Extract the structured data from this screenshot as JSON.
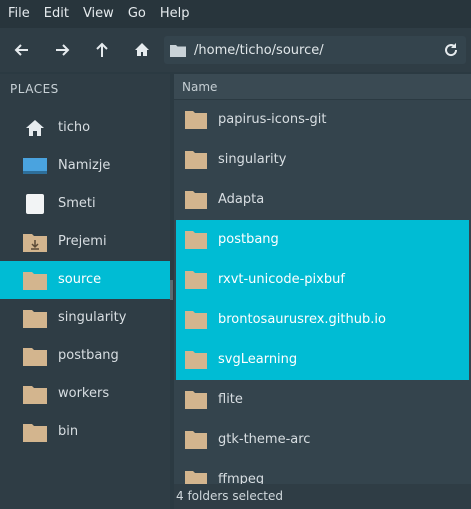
{
  "menubar": {
    "items": [
      "File",
      "Edit",
      "View",
      "Go",
      "Help"
    ]
  },
  "toolbar": {
    "back_icon": "arrow-left-icon",
    "forward_icon": "arrow-right-icon",
    "up_icon": "arrow-up-icon",
    "home_icon": "home-icon",
    "location_path": "/home/ticho/source/",
    "reload_icon": "reload-icon"
  },
  "sidebar": {
    "heading": "PLACES",
    "items": [
      {
        "label": "ticho",
        "icon": "home-icon",
        "active": false
      },
      {
        "label": "Namizje",
        "icon": "desktop-icon",
        "active": false
      },
      {
        "label": "Smeti",
        "icon": "trash-icon",
        "active": false
      },
      {
        "label": "Prejemi",
        "icon": "downloads-folder-icon",
        "active": false
      },
      {
        "label": "source",
        "icon": "folder-icon",
        "active": true
      },
      {
        "label": "singularity",
        "icon": "folder-icon",
        "active": false
      },
      {
        "label": "postbang",
        "icon": "folder-icon",
        "active": false
      },
      {
        "label": "workers",
        "icon": "folder-icon",
        "active": false
      },
      {
        "label": "bin",
        "icon": "folder-icon",
        "active": false
      }
    ]
  },
  "file_list": {
    "column_header": "Name",
    "rows": [
      {
        "name": "papirus-icons-git",
        "selected": false
      },
      {
        "name": "singularity",
        "selected": false
      },
      {
        "name": "Adapta",
        "selected": false
      },
      {
        "name": "postbang",
        "selected": true
      },
      {
        "name": "rxvt-unicode-pixbuf",
        "selected": true
      },
      {
        "name": "brontosaurusrex.github.io",
        "selected": true
      },
      {
        "name": "svgLearning",
        "selected": true
      },
      {
        "name": "flite",
        "selected": false
      },
      {
        "name": "gtk-theme-arc",
        "selected": false
      },
      {
        "name": "ffmpeg",
        "selected": false
      }
    ]
  },
  "status": {
    "text": "4 folders selected"
  },
  "colors": {
    "accent": "#00bcd4",
    "folder": "#d3b58e"
  }
}
